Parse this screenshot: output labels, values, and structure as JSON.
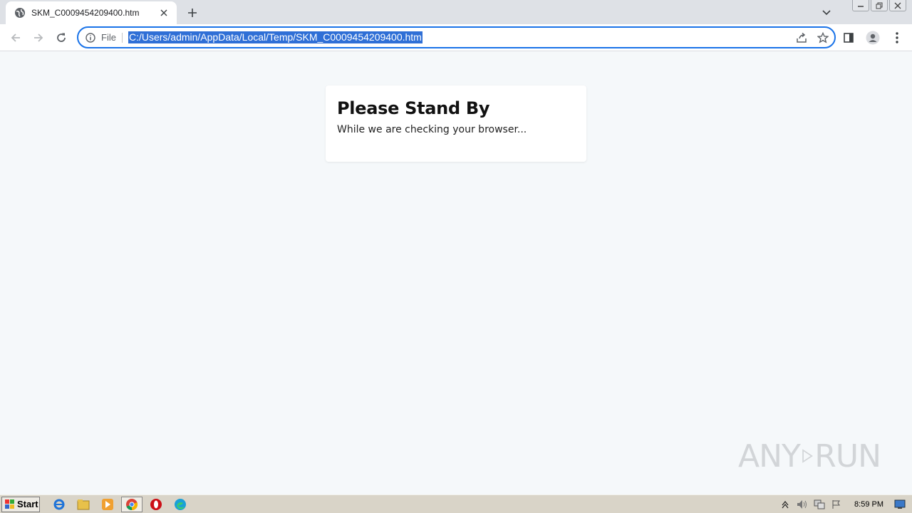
{
  "browser": {
    "tab": {
      "title": "SKM_C0009454209400.htm"
    },
    "omnibox": {
      "scheme_label": "File",
      "url": "C:/Users/admin/AppData/Local/Temp/SKM_C0009454209400.htm"
    }
  },
  "page": {
    "heading": "Please Stand By",
    "message": "While we are checking your browser..."
  },
  "watermark": {
    "left": "ANY",
    "right": "RUN"
  },
  "taskbar": {
    "start_label": "Start",
    "clock": "8:59 PM",
    "apps": [
      "ie-icon",
      "explorer-icon",
      "media-player-icon",
      "chrome-icon",
      "opera-icon",
      "edge-icon"
    ]
  },
  "colors": {
    "accent": "#1a73e8",
    "selection": "#2f6fd6",
    "page_bg": "#f5f8fa"
  }
}
